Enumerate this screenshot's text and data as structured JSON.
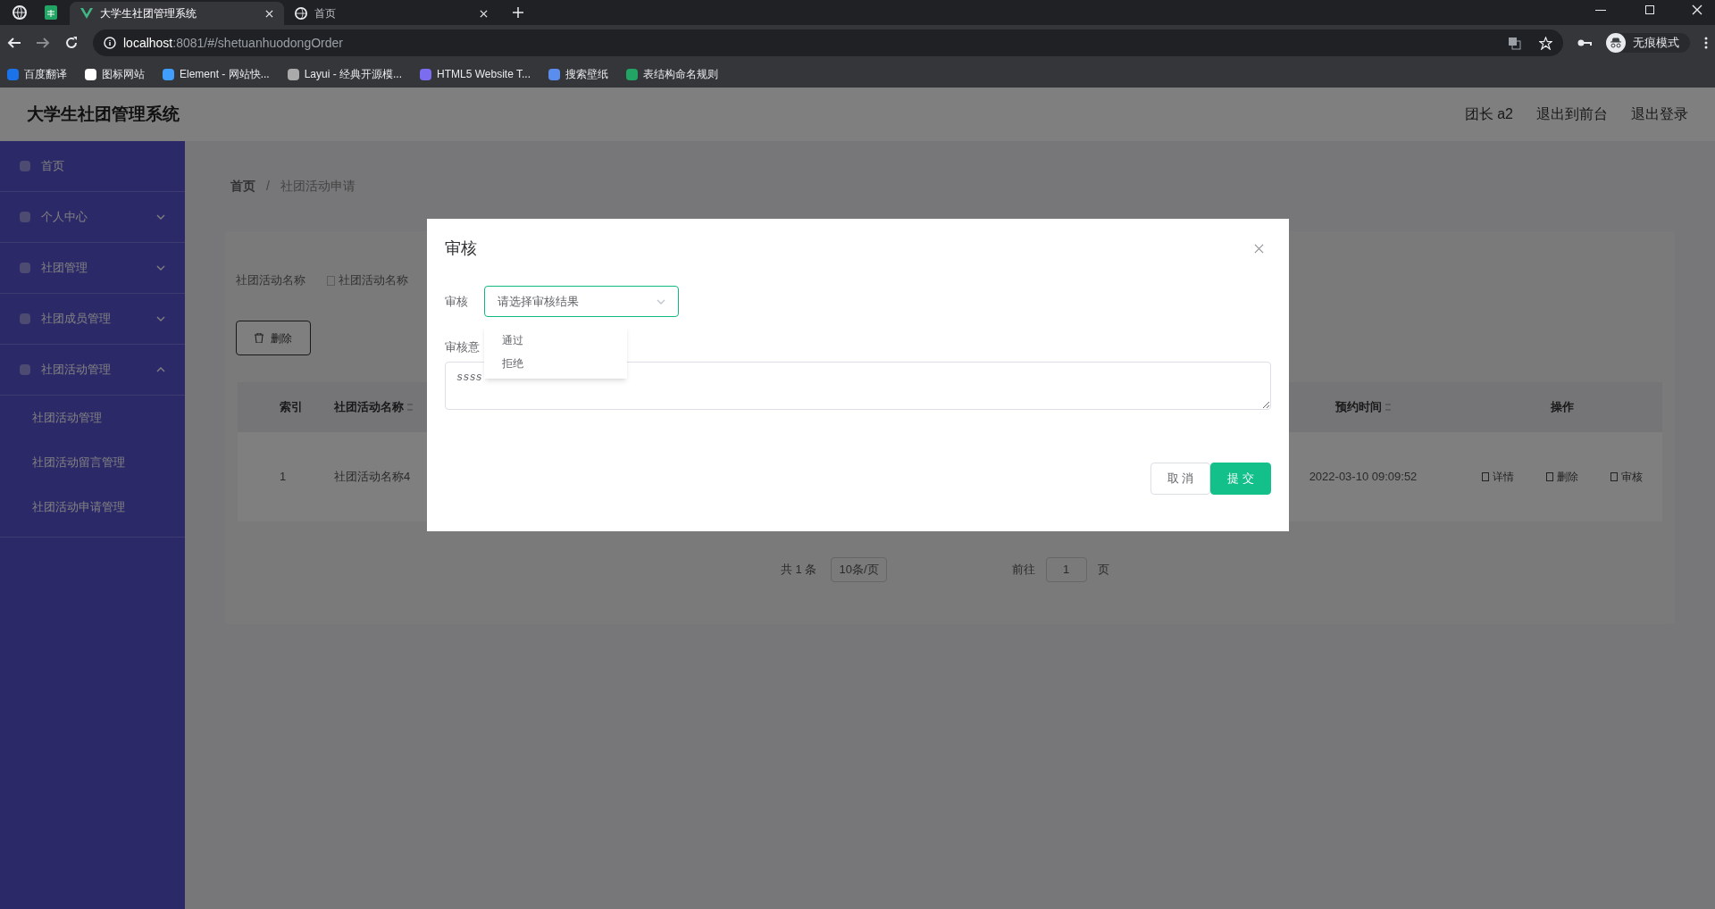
{
  "browser": {
    "tabs": [
      {
        "title": "大学生社团管理系统",
        "selected": true
      },
      {
        "title": "首页",
        "selected": false
      }
    ],
    "address": {
      "host": "localhost",
      "path": ":8081/#/shetuanhuodongOrder"
    },
    "bookmarks": [
      "百度翻译",
      "图标网站",
      "Element - 网站快...",
      "Layui - 经典开源模...",
      "HTML5 Website T...",
      "搜索壁纸",
      "表结构命名规则"
    ],
    "profile": "无痕模式"
  },
  "header": {
    "title": "大学生社团管理系统",
    "user": "团长 a2",
    "links": [
      "退出到前台",
      "退出登录"
    ]
  },
  "sidebar": {
    "items": [
      {
        "label": "首页"
      },
      {
        "label": "个人中心",
        "expanded": false
      },
      {
        "label": "社团管理",
        "expanded": false
      },
      {
        "label": "社团成员管理",
        "expanded": false
      },
      {
        "label": "社团活动管理",
        "expanded": true,
        "children": [
          {
            "label": "社团活动管理"
          },
          {
            "label": "社团活动留言管理"
          },
          {
            "label": "社团活动申请管理"
          }
        ]
      }
    ]
  },
  "breadcrumb": [
    "首页",
    "社团活动申请"
  ],
  "breadcrumb_separator": "/",
  "search": {
    "label": "社团活动名称",
    "placeholder": "社团活动名称"
  },
  "delete_button": "删除",
  "table": {
    "columns": [
      {
        "label": "索引",
        "sortable": false
      },
      {
        "label": "社团活动名称",
        "sortable": true
      },
      {
        "label": "预约时间",
        "sortable": true
      },
      {
        "label": "操作",
        "sortable": false
      }
    ],
    "rows": [
      {
        "cells": [
          "1",
          "社团活动名称4",
          "2022-03-10 09:09:52"
        ],
        "actions": [
          "详情",
          "删除",
          "审核"
        ]
      }
    ]
  },
  "pagination": {
    "total": "共 1 条",
    "page_size": "10条/页",
    "goto": "前往",
    "page": "1",
    "suffix": "页"
  },
  "dialog": {
    "title": "审核",
    "fields": [
      {
        "kind": "select",
        "label": "审核",
        "placeholder": "请选择审核结果",
        "expanded": true,
        "options": [
          "通过",
          "拒绝"
        ]
      },
      {
        "kind": "textarea",
        "label": "审核意",
        "value": "ssss"
      }
    ],
    "buttons": [
      {
        "label": "取 消",
        "kind": "default"
      },
      {
        "label": "提 交",
        "kind": "primary"
      }
    ]
  }
}
